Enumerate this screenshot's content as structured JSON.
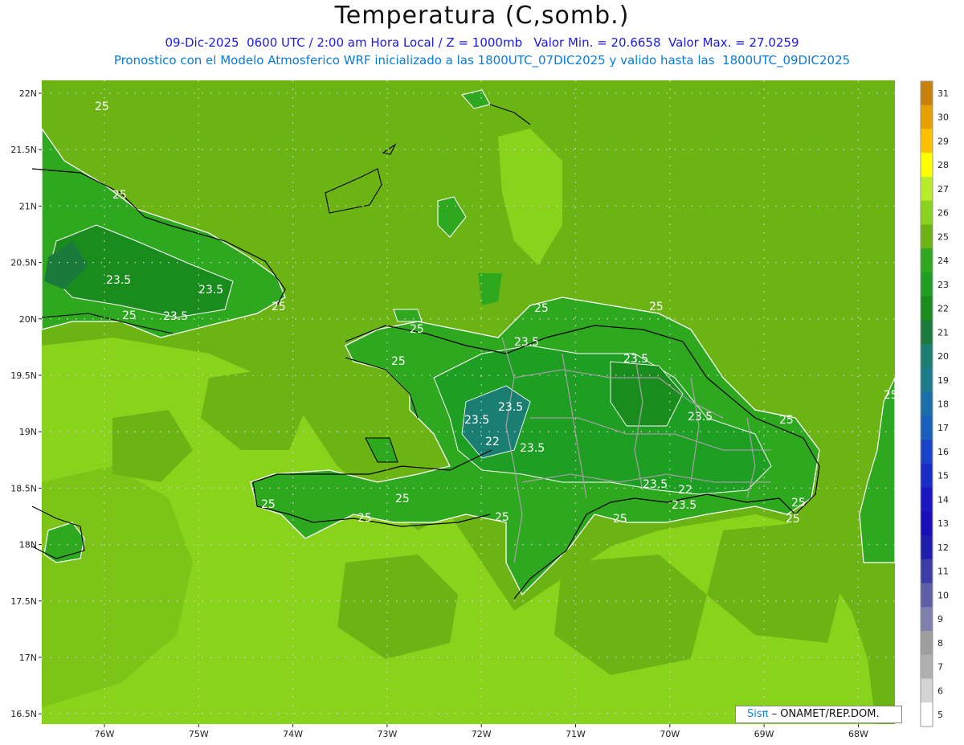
{
  "title": "Temperatura (C,somb.)",
  "subtitle_1": "09-Dic-2025  0600 UTC / 2:00 am Hora Local / Z = 1000mb   Valor Min. = 20.6658  Valor Max. = 27.0259",
  "subtitle_2": "Pronostico con el Modelo Atmosferico WRF inicializado a las 1800UTC_07DIC2025 y valido hasta las  1800UTC_09DIC2025",
  "credit": {
    "brand": "Sisπ",
    "text": "– ONAMET/REP.DOM."
  },
  "axes": {
    "lat_labels": [
      "22N",
      "21.5N",
      "21N",
      "20.5N",
      "20N",
      "19.5N",
      "19N",
      "18.5N",
      "18N",
      "17.5N",
      "17N",
      "16.5N"
    ],
    "lon_labels": [
      "76W",
      "75W",
      "74W",
      "73W",
      "72W",
      "71W",
      "70W",
      "69W",
      "68W"
    ]
  },
  "contour_labels": [
    "25",
    "25",
    "23.5",
    "23.5",
    "25",
    "25",
    "23.5",
    "25",
    "25",
    "25",
    "23.5",
    "25",
    "23.5",
    "25",
    "25",
    "23.5",
    "23.5",
    "22",
    "23.5",
    "23.5",
    "22",
    "23.5",
    "25",
    "25",
    "25",
    "25",
    "25",
    "23.5",
    "25",
    "25"
  ],
  "colorbar": {
    "labels": [
      "31",
      "30",
      "29",
      "28",
      "27",
      "26",
      "25",
      "24",
      "23",
      "22",
      "21",
      "20",
      "19",
      "18",
      "17",
      "16",
      "15",
      "14",
      "13",
      "12",
      "11",
      "10",
      "9",
      "8",
      "7",
      "6",
      "5"
    ],
    "colors": [
      "#c8820a",
      "#e6a000",
      "#ffc000",
      "#ffff00",
      "#b8ec28",
      "#8ad31c",
      "#6cb414",
      "#2ea81e",
      "#1e9e22",
      "#1a8c1e",
      "#1a7a3c",
      "#1a7f72",
      "#1a7b8a",
      "#1a6fa8",
      "#1a5fbe",
      "#1a44c8",
      "#1a2cc8",
      "#1a16c0",
      "#1a0ebc",
      "#1e1eae",
      "#3c3ca8",
      "#5e5ea8",
      "#8080ae",
      "#9e9e9e",
      "#b0b0b0",
      "#d4d4d4",
      "#ffffff"
    ]
  },
  "colors": {
    "ocean_base": "#6cb414",
    "warm_sea": "#8ad31c",
    "land_mid": "#2ea81e",
    "land_cool": "#1a8c1e",
    "land_cold": "#1a7f72",
    "title_blue": "#1a1ae6",
    "subtitle_blue": "#0a7be0"
  }
}
